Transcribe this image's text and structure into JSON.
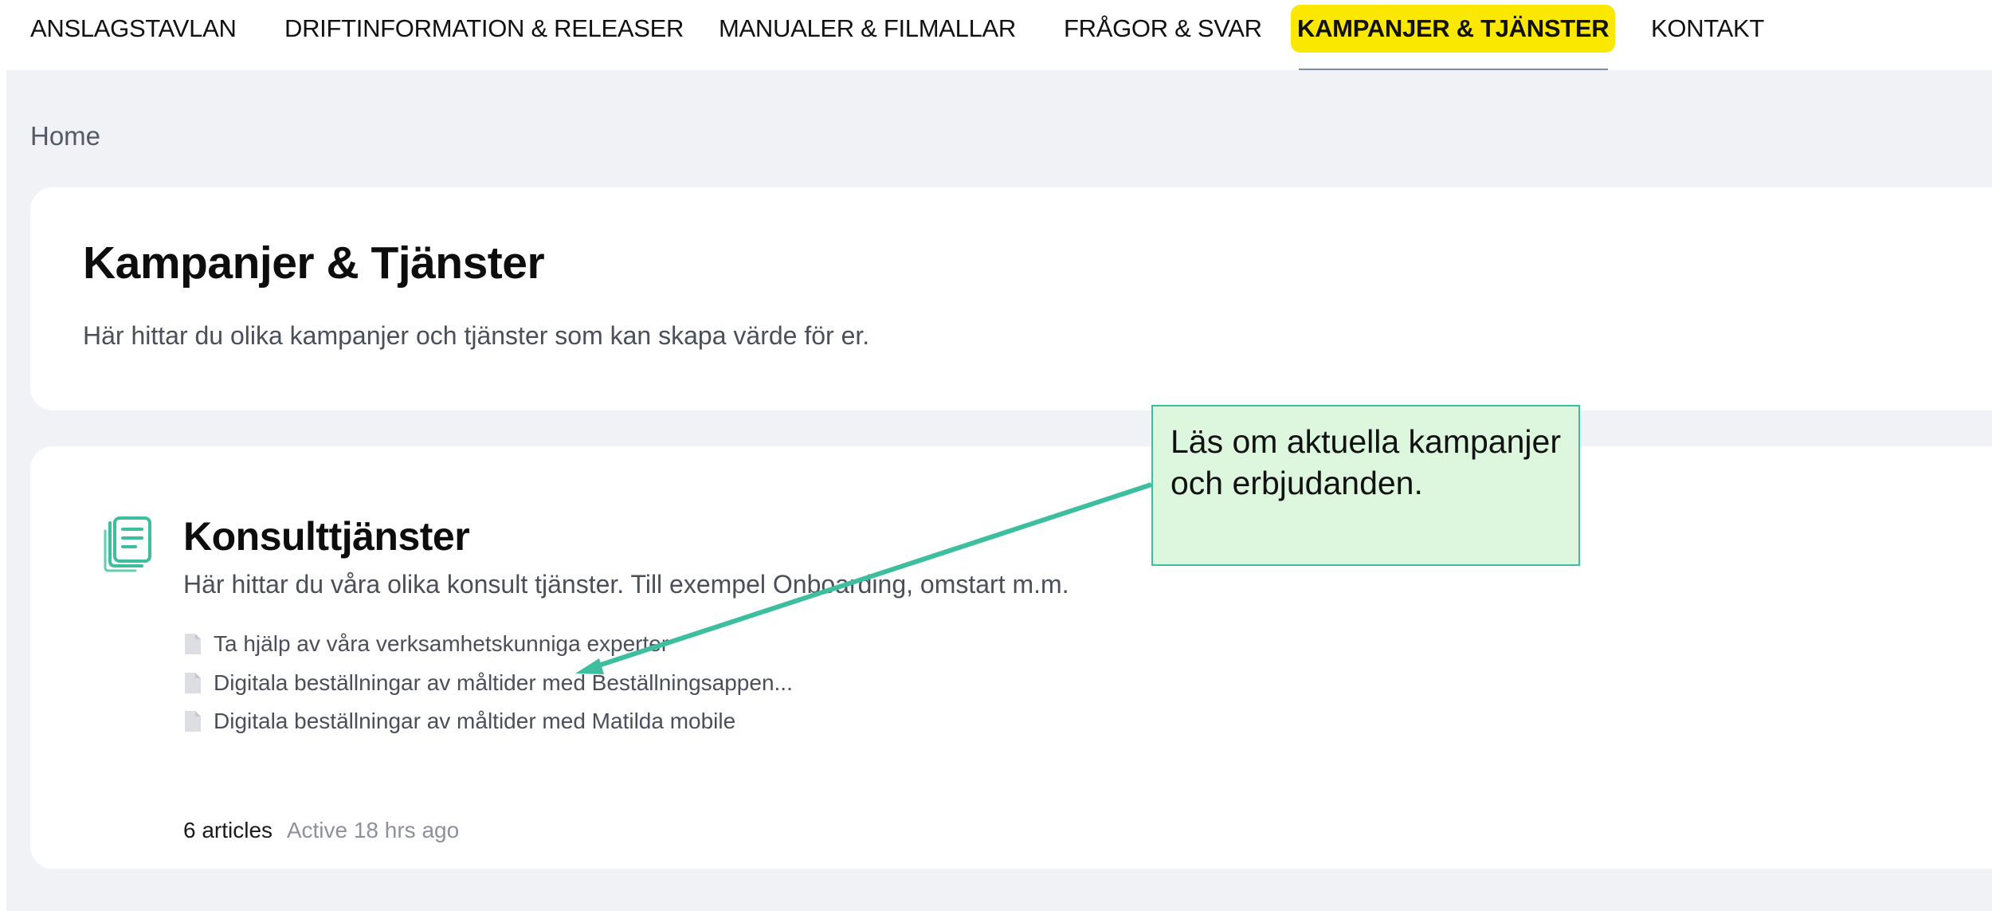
{
  "nav": {
    "items": [
      {
        "label": "ANSLAGSTAVLAN"
      },
      {
        "label": "DRIFTINFORMATION & RELEASER"
      },
      {
        "label": "MANUALER & FILMALLAR"
      },
      {
        "label": "FRÅGOR & SVAR"
      },
      {
        "label": "KAMPANJER & TJÄNSTER",
        "active": true
      },
      {
        "label": "KONTAKT"
      }
    ]
  },
  "breadcrumb": {
    "home": "Home"
  },
  "header": {
    "title": "Kampanjer & Tjänster",
    "description": "Här hittar du olika kampanjer och tjänster som kan skapa värde för er."
  },
  "section": {
    "icon": "article-list-icon",
    "title": "Konsulttjänster",
    "description": "Här hittar du våra olika konsult tjänster. Till exempel Onboarding, omstart m.m.",
    "articles": [
      {
        "title": "Ta hjälp av våra verksamhetskunniga experter",
        "icon": "document-icon"
      },
      {
        "title": "Digitala beställningar av måltider med Beställningsappen...",
        "icon": "document-icon"
      },
      {
        "title": "Digitala beställningar av måltider med Matilda mobile",
        "icon": "document-icon"
      }
    ],
    "article_count": "6 articles",
    "activity": "Active 18 hrs ago"
  },
  "annotation": {
    "text": "Läs om aktuella kampanjer och erbjudanden."
  },
  "colors": {
    "highlight": "#fbe800",
    "accent": "#3dbf9f",
    "callout_bg": "#dcf7dd",
    "page_bg": "#f1f2f6"
  }
}
